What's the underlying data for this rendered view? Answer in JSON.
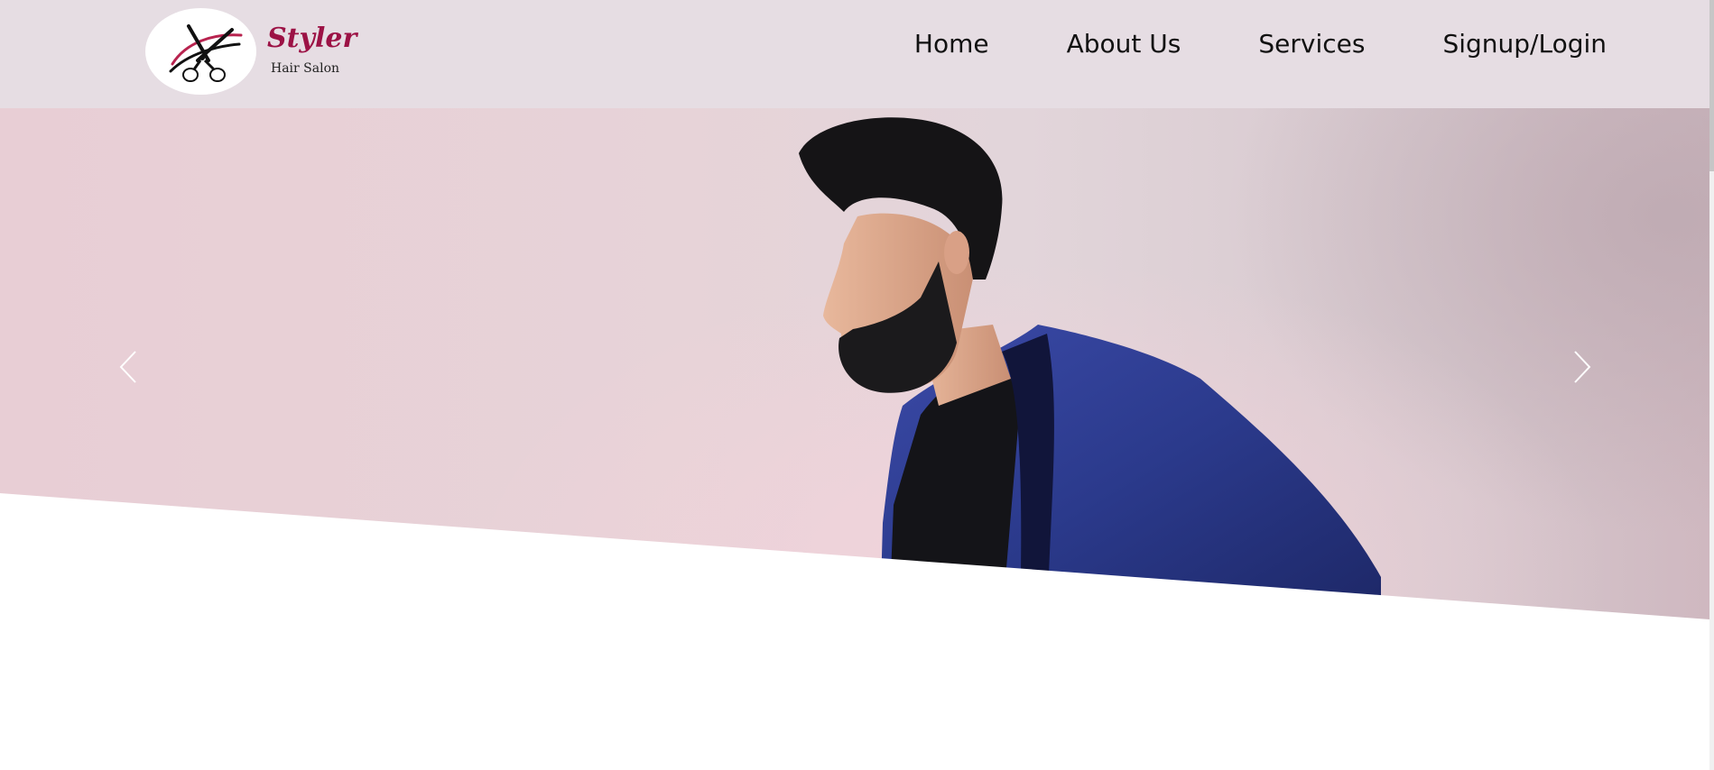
{
  "brand": {
    "name": "Styler",
    "tagline": "Hair Salon",
    "logo_icon": "scissors-icon",
    "name_color": "#9c1245"
  },
  "nav": {
    "items": [
      {
        "label": "Home"
      },
      {
        "label": "About Us"
      },
      {
        "label": "Services"
      },
      {
        "label": "Signup/Login"
      }
    ]
  },
  "hero": {
    "image_description": "man-with-beard-in-blue-blazer",
    "prev_icon": "chevron-left-icon",
    "next_icon": "chevron-right-icon"
  },
  "colors": {
    "header_bg": "#e6dde3",
    "accent": "#9c1245",
    "blazer": "#2b3a8c"
  }
}
